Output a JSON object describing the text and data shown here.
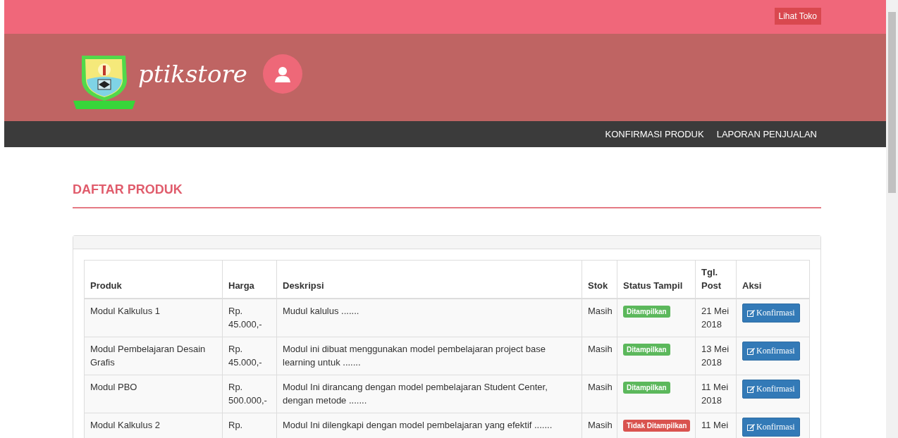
{
  "topbar": {
    "button": "Lihat Toko"
  },
  "header": {
    "brand": "ptikstore"
  },
  "nav": {
    "items": [
      "KONFIRMASI PRODUK",
      "LAPORAN PENJUALAN"
    ]
  },
  "page": {
    "title": "DAFTAR PRODUK"
  },
  "table": {
    "columns": [
      "Produk",
      "Harga",
      "Deskripsi",
      "Stok",
      "Status Tampil",
      "Tgl. Post",
      "Aksi"
    ],
    "rows": [
      {
        "produk": "Modul Kalkulus 1",
        "harga": "Rp. 45.000,-",
        "deskripsi": "Mudul kalulus .......",
        "stok": "Masih",
        "status": {
          "label": "Ditampilkan",
          "kind": "shown"
        },
        "tgl": "21 Mei 2018",
        "aksi": "Konfirmasi"
      },
      {
        "produk": "Modul Pembelajaran Desain Grafis",
        "harga": "Rp. 45.000,-",
        "deskripsi": "Modul ini dibuat menggunakan model pembelajaran project base learning untuk .......",
        "stok": "Masih",
        "status": {
          "label": "Ditampilkan",
          "kind": "shown"
        },
        "tgl": "13 Mei 2018",
        "aksi": "Konfirmasi"
      },
      {
        "produk": "Modul PBO",
        "harga": "Rp. 500.000,-",
        "deskripsi": "Modul Ini dirancang dengan model pembelajaran Student Center, dengan metode .......",
        "stok": "Masih",
        "status": {
          "label": "Ditampilkan",
          "kind": "shown"
        },
        "tgl": "11 Mei 2018",
        "aksi": "Konfirmasi"
      },
      {
        "produk": "Modul Kalkulus 2",
        "harga": "Rp.",
        "deskripsi": "Modul Ini dilengkapi dengan model pembelajaran yang efektif .......",
        "stok": "Masih",
        "status": {
          "label": "Tidak Ditampilkan",
          "kind": "hidden"
        },
        "tgl": "11 Mei",
        "aksi": "Konfirmasi"
      }
    ]
  }
}
